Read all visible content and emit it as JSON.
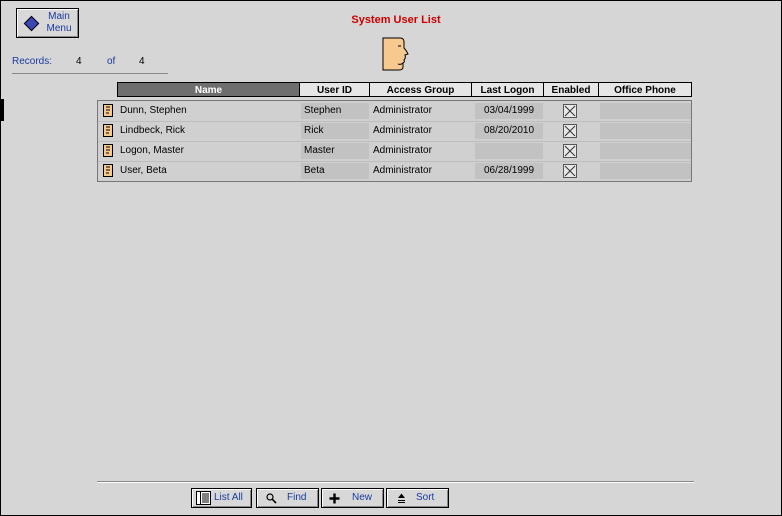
{
  "window": {
    "title": "System User List"
  },
  "main_menu": {
    "line1": "Main",
    "line2": "Menu"
  },
  "records": {
    "label": "Records:",
    "count": "4",
    "of_label": "of",
    "total": "4"
  },
  "table": {
    "headers": {
      "name": "Name",
      "user_id": "User ID",
      "access_group": "Access Group",
      "last_logon": "Last Logon",
      "enabled": "Enabled",
      "office_phone": "Office Phone"
    },
    "rows": [
      {
        "name": "Dunn, Stephen",
        "user_id": "Stephen",
        "access_group": "Administrator",
        "last_logon": "03/04/1999",
        "enabled": true,
        "office_phone": ""
      },
      {
        "name": "Lindbeck, Rick",
        "user_id": "Rick",
        "access_group": "Administrator",
        "last_logon": "08/20/2010",
        "enabled": true,
        "office_phone": ""
      },
      {
        "name": "Logon, Master",
        "user_id": "Master",
        "access_group": "Administrator",
        "last_logon": "",
        "enabled": true,
        "office_phone": ""
      },
      {
        "name": "User, Beta",
        "user_id": "Beta",
        "access_group": "Administrator",
        "last_logon": "06/28/1999",
        "enabled": true,
        "office_phone": ""
      }
    ]
  },
  "toolbar": {
    "list_all": "List All",
    "find": "Find",
    "new": "New",
    "sort": "Sort"
  },
  "icons": {
    "main_menu": "diamond-icon",
    "header": "face-icon",
    "row": "document-icon",
    "list_all": "list-icon",
    "find": "magnifier-icon",
    "new": "plus-icon",
    "sort": "sort-icon"
  },
  "colors": {
    "title": "#cc0000",
    "accent": "#1a3aa0",
    "face": "#f7c98f",
    "sorted_header": "#6e6e6e"
  }
}
